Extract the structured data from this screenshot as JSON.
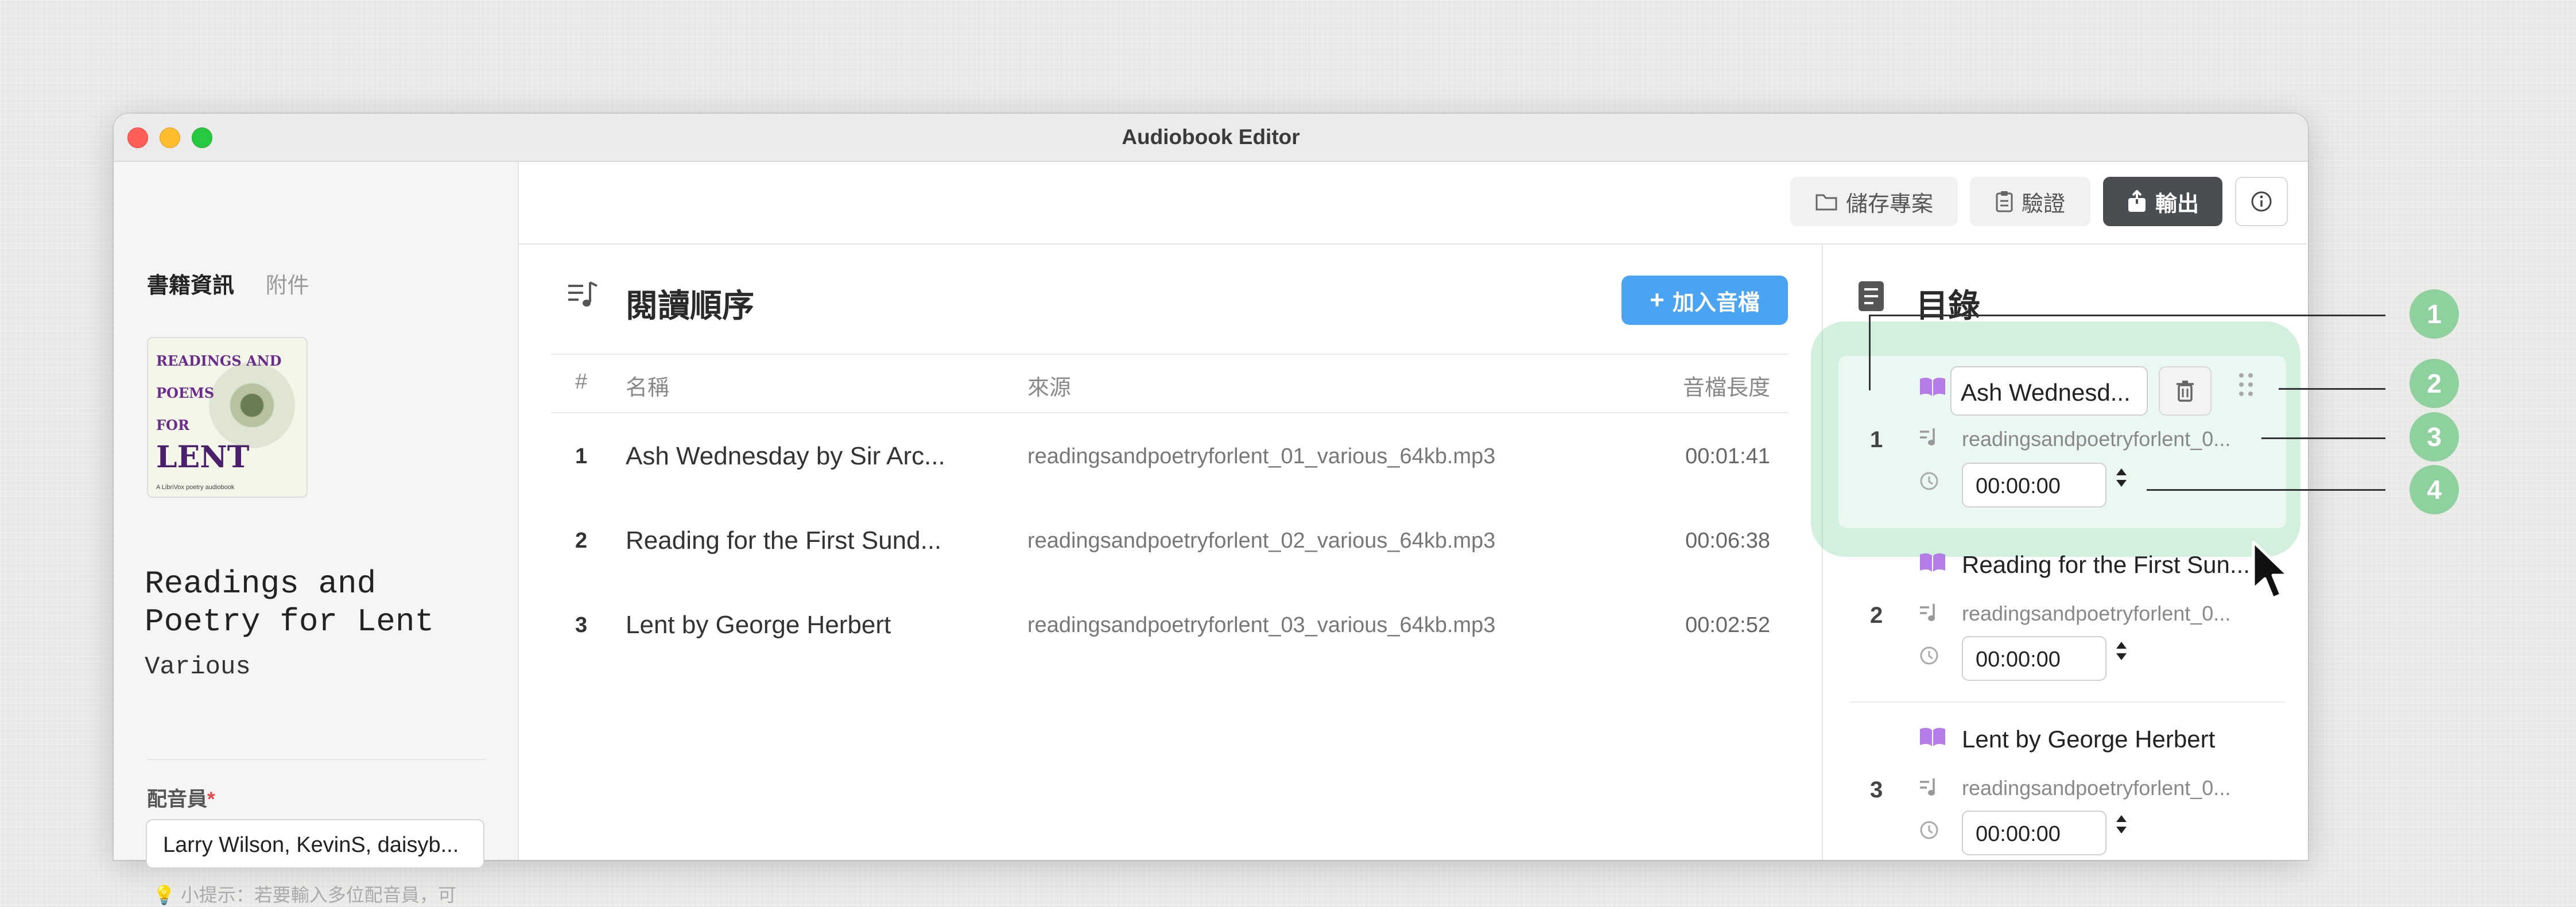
{
  "window": {
    "title": "Audiobook Editor"
  },
  "sidebar": {
    "tabs": [
      {
        "label": "書籍資訊",
        "active": true
      },
      {
        "label": "附件",
        "active": false
      }
    ],
    "cover": {
      "line1": "READINGS AND",
      "line2": "POEMS",
      "line3": "FOR",
      "line4": "LENT",
      "small": "A LibriVox poetry audiobook"
    },
    "book_title": "Readings and Poetry for Lent",
    "author": "Various",
    "narrator_label": "配音員",
    "narrator_required_mark": "*",
    "narrator_value": "Larry Wilson, KevinS, daisyb...",
    "tip": "💡 小提示：若要輸入多位配音員，可"
  },
  "toolbar": {
    "save_label": "儲存專案",
    "validate_label": "驗證",
    "export_label": "輸出"
  },
  "reading_order": {
    "title": "閱讀順序",
    "add_label": "加入音檔",
    "columns": {
      "num": "#",
      "name": "名稱",
      "source": "來源",
      "duration": "音檔長度"
    },
    "rows": [
      {
        "num": "1",
        "name": "Ash Wednesday by Sir Arc...",
        "source": "readingsandpoetryforlent_01_various_64kb.mp3",
        "duration": "00:01:41"
      },
      {
        "num": "2",
        "name": "Reading for the First Sund...",
        "source": "readingsandpoetryforlent_02_various_64kb.mp3",
        "duration": "00:06:38"
      },
      {
        "num": "3",
        "name": "Lent by George Herbert",
        "source": "readingsandpoetryforlent_03_various_64kb.mp3",
        "duration": "00:02:52"
      }
    ]
  },
  "toc": {
    "title": "目錄",
    "items": [
      {
        "num": "1",
        "name": "Ash Wednesd...",
        "source": "readingsandpoetryforlent_0...",
        "time": "00:00:00"
      },
      {
        "num": "2",
        "name": "Reading for the First Sun...",
        "source": "readingsandpoetryforlent_0...",
        "time": "00:00:00"
      },
      {
        "num": "3",
        "name": "Lent by George Herbert",
        "source": "readingsandpoetryforlent_0...",
        "time": "00:00:00"
      }
    ]
  },
  "callouts": [
    "1",
    "2",
    "3",
    "4"
  ],
  "colors": {
    "accent": "#4aa3f3",
    "export": "#4a4d52",
    "highlight": "#8cd7aa",
    "callout": "#8fd19e",
    "book_icon": "#b57be6"
  }
}
